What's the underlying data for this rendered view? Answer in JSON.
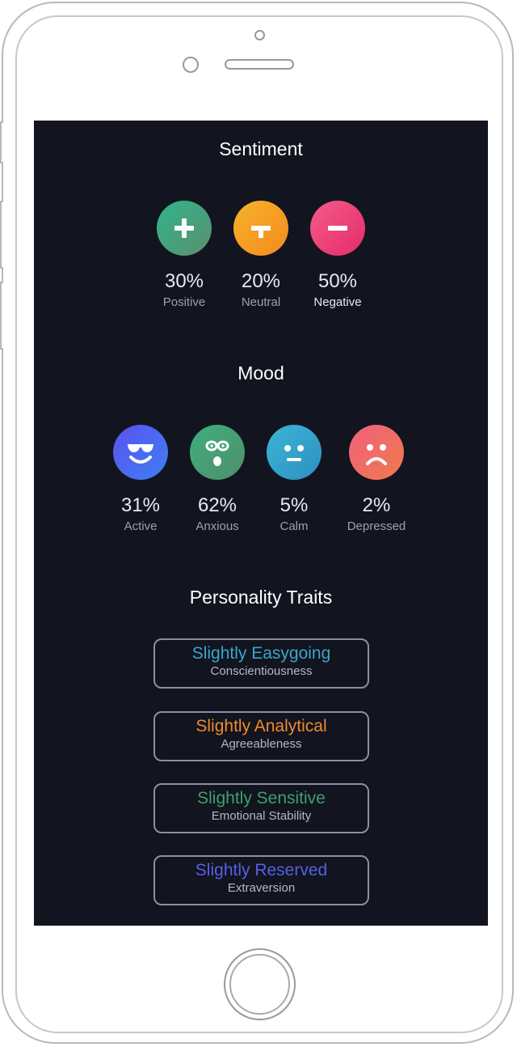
{
  "sentiment": {
    "title": "Sentiment",
    "items": [
      {
        "value": "30%",
        "label": "Positive",
        "icon": "plus-icon",
        "colors": [
          "#2fb58a",
          "#5c8f6f"
        ]
      },
      {
        "value": "20%",
        "label": "Neutral",
        "icon": "neutral-icon",
        "colors": [
          "#f7b32b",
          "#f28a1e"
        ]
      },
      {
        "value": "50%",
        "label": "Negative",
        "icon": "minus-icon",
        "colors": [
          "#f45c8a",
          "#e52b6a"
        ]
      }
    ]
  },
  "mood": {
    "title": "Mood",
    "items": [
      {
        "value": "31%",
        "label": "Active",
        "icon": "sunglasses-face-icon",
        "colors": [
          "#5a52f0",
          "#3f7ff2"
        ]
      },
      {
        "value": "62%",
        "label": "Anxious",
        "icon": "surprised-face-icon",
        "colors": [
          "#3fae7c",
          "#4f8f6e"
        ]
      },
      {
        "value": "5%",
        "label": "Calm",
        "icon": "neutral-face-icon",
        "colors": [
          "#3ab6d6",
          "#2f8fc0"
        ]
      },
      {
        "value": "2%",
        "label": "Depressed",
        "icon": "sad-face-icon",
        "colors": [
          "#f06080",
          "#f07a4a"
        ]
      }
    ]
  },
  "personality": {
    "title": "Personality Traits",
    "traits": [
      {
        "title": "Slightly Easygoing",
        "subtitle": "Conscientiousness",
        "color": "#3aa6c8"
      },
      {
        "title": "Slightly Analytical",
        "subtitle": "Agreeableness",
        "color": "#f08a2a"
      },
      {
        "title": "Slightly Sensitive",
        "subtitle": "Emotional Stability",
        "color": "#3fa06a"
      },
      {
        "title": "Slightly Reserved",
        "subtitle": "Extraversion",
        "color": "#5560e8"
      }
    ]
  }
}
